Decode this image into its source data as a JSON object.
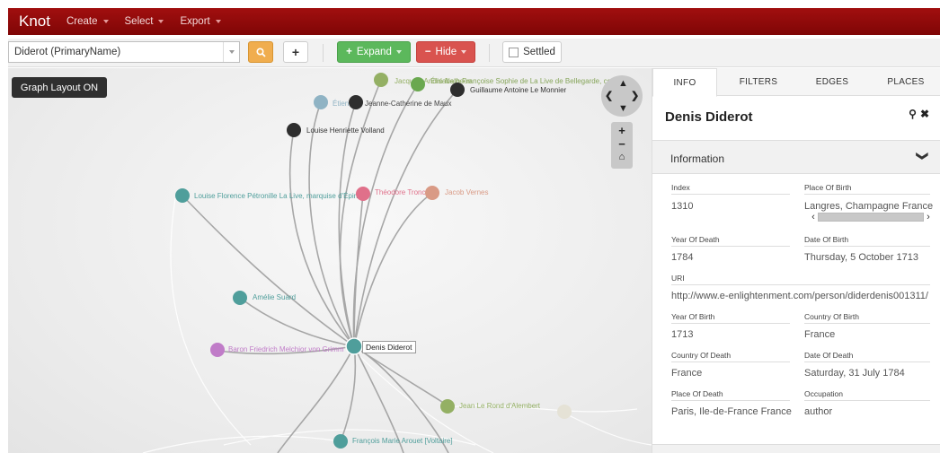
{
  "navbar": {
    "brand": "Knot",
    "menus": [
      {
        "label": "Create"
      },
      {
        "label": "Select"
      },
      {
        "label": "Export"
      }
    ]
  },
  "toolbar": {
    "search_value": "Diderot (PrimaryName)",
    "search_button_icon": "search-icon",
    "add_button_label": "+",
    "expand_label": "Expand",
    "hide_label": "Hide",
    "settled_label": "Settled",
    "settled_checked": false
  },
  "graph": {
    "layout_button": "Graph Layout ON",
    "focus_node": "Denis Diderot",
    "nodes": [
      {
        "label": "Jacques-André Naigeon"
      },
      {
        "label": "Élisabeth Françoise Sophie de La Live de Bellegarde, comtesse"
      },
      {
        "label": "Guillaume Antoine Le Monnier"
      },
      {
        "label": "Étienne"
      },
      {
        "label": "Jeanne-Catherine de Maux"
      },
      {
        "label": "Louise Henriette Volland"
      },
      {
        "label": "Louise Florence Pétronille La Live, marquise d'Épinay"
      },
      {
        "label": "Théodore Tronchin"
      },
      {
        "label": "Jacob Vernes"
      },
      {
        "label": "Amélie Suard"
      },
      {
        "label": "Baron Friedrich Melchior von Grimm"
      },
      {
        "label": "Jean Le Rond d'Alembert"
      },
      {
        "label": "François Marie Arouet [Voltaire]"
      }
    ]
  },
  "panel": {
    "tabs": [
      "INFO",
      "FILTERS",
      "EDGES",
      "PLACES"
    ],
    "active_tab": "INFO",
    "title": "Denis Diderot",
    "section": "Information",
    "fields": {
      "index": {
        "label": "Index",
        "value": "1310"
      },
      "place_of_birth": {
        "label": "Place Of Birth",
        "value": "Langres, Champagne France"
      },
      "year_of_death": {
        "label": "Year Of Death",
        "value": "1784"
      },
      "date_of_birth": {
        "label": "Date Of Birth",
        "value": "Thursday, 5 October 1713"
      },
      "uri": {
        "label": "URI",
        "value": "http://www.e-enlightenment.com/person/diderdenis001311/"
      },
      "year_of_birth": {
        "label": "Year Of Birth",
        "value": "1713"
      },
      "country_of_birth": {
        "label": "Country Of Birth",
        "value": "France"
      },
      "country_of_death": {
        "label": "Country Of Death",
        "value": "France"
      },
      "date_of_death": {
        "label": "Date Of Death",
        "value": "Saturday, 31 July 1784"
      },
      "place_of_death": {
        "label": "Place Of Death",
        "value": "Paris, Ile-de-France France"
      },
      "occupation": {
        "label": "Occupation",
        "value": "author"
      }
    }
  },
  "colors": {
    "navbar": "#8b0a0a",
    "teal": "#4f9e9b",
    "green": "#94b064",
    "dark": "#2e2e2e",
    "steel": "#8fb3c4",
    "pink": "#e0708a",
    "salmon": "#d99a85",
    "violet": "#c07cc8"
  }
}
